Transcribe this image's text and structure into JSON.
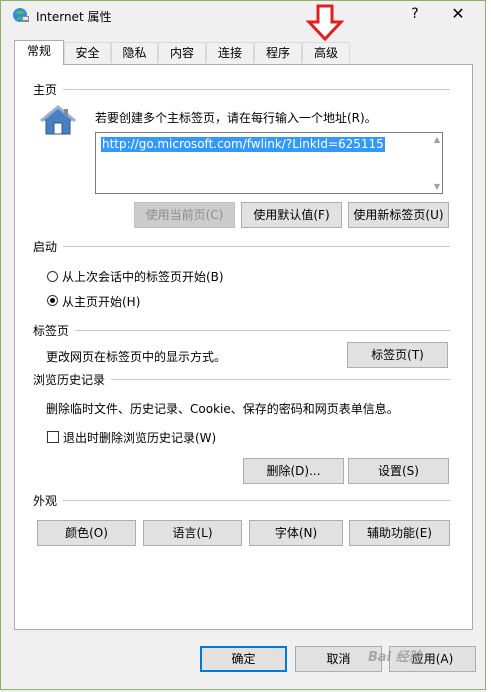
{
  "window": {
    "title": "Internet 属性",
    "help_glyph": "?",
    "close_glyph": "✕"
  },
  "tabs": [
    {
      "label": "常规",
      "active": true
    },
    {
      "label": "安全",
      "active": false
    },
    {
      "label": "隐私",
      "active": false
    },
    {
      "label": "内容",
      "active": false
    },
    {
      "label": "连接",
      "active": false
    },
    {
      "label": "程序",
      "active": false
    },
    {
      "label": "高级",
      "active": false
    }
  ],
  "home": {
    "heading": "主页",
    "instruction": "若要创建多个主标签页，请在每行输入一个地址(R)。",
    "url": "http://go.microsoft.com/fwlink/?LinkId=625115",
    "use_current": "使用当前页(C)",
    "use_default": "使用默认值(F)",
    "use_new_tab": "使用新标签页(U)"
  },
  "startup": {
    "heading": "启动",
    "option_last_session": "从上次会话中的标签页开始(B)",
    "option_home": "从主页开始(H)",
    "selected": "home"
  },
  "tabs_section": {
    "heading": "标签页",
    "description": "更改网页在标签页中的显示方式。",
    "button": "标签页(T)"
  },
  "history": {
    "heading": "浏览历史记录",
    "description": "删除临时文件、历史记录、Cookie、保存的密码和网页表单信息。",
    "checkbox_label": "退出时删除浏览历史记录(W)",
    "checked": false,
    "delete_button": "删除(D)...",
    "settings_button": "设置(S)"
  },
  "appearance": {
    "heading": "外观",
    "colors": "颜色(O)",
    "languages": "语言(L)",
    "fonts": "字体(N)",
    "accessibility": "辅助功能(E)"
  },
  "footer": {
    "ok": "确定",
    "cancel": "取消",
    "apply": "应用(A)"
  },
  "watermark": "Bai 经验",
  "colors": {
    "accent": "#0078d7",
    "selection": "#3399ff",
    "arrow": "#e02020"
  }
}
